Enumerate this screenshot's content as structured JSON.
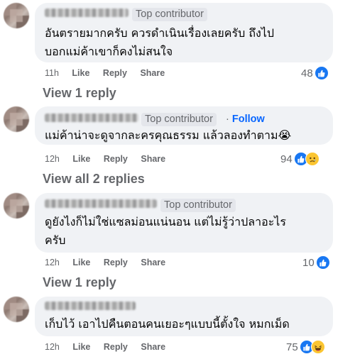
{
  "comments": [
    {
      "badge": "Top contributor",
      "follow": "",
      "text_lines": [
        "อันตรายมากครับ ควรดำเนินเรื่องเลยครับ ถึงไป",
        "บอกแม่ค้าเขาก็คงไม่สนใจ"
      ],
      "time": "11h",
      "like": "Like",
      "reply": "Reply",
      "share": "Share",
      "reaction_count": "48",
      "reactions": [
        "like-icon"
      ],
      "view_replies": "View 1 reply"
    },
    {
      "badge": "Top contributor",
      "follow": "Follow",
      "text_lines": [
        "แม่ค้าน่าจะดูจากละครคุณธรรม แล้วลองทำตาม😭"
      ],
      "time": "12h",
      "like": "Like",
      "reply": "Reply",
      "share": "Share",
      "reaction_count": "94",
      "reactions": [
        "like-icon",
        "sad-icon"
      ],
      "view_replies": "View all 2 replies"
    },
    {
      "badge": "Top contributor",
      "follow": "",
      "text_lines": [
        "ดูยังไงก็ไม่ใช่แซลม่อนแน่นอน แต่ไม่รู้ว่าปลาอะไร",
        "ครับ"
      ],
      "time": "12h",
      "like": "Like",
      "reply": "Reply",
      "share": "Share",
      "reaction_count": "10",
      "reactions": [
        "like-icon"
      ],
      "view_replies": "View 1 reply"
    },
    {
      "badge": "",
      "follow": "",
      "text_lines": [
        "เก็บไว้ เอาไปคืนตอนคนเยอะๆแบบนี้ตั้งใจ หมกเม็ด"
      ],
      "time": "12h",
      "like": "Like",
      "reply": "Reply",
      "share": "Share",
      "reaction_count": "75",
      "reactions": [
        "like-icon",
        "haha-icon"
      ],
      "view_replies": ""
    }
  ],
  "colors": {
    "bubble": "#f0f2f5",
    "meta_text": "#65676b",
    "link_blue": "#0866ff",
    "like_blue": "#1877f2",
    "emoji_yellow": "#fbc531"
  }
}
